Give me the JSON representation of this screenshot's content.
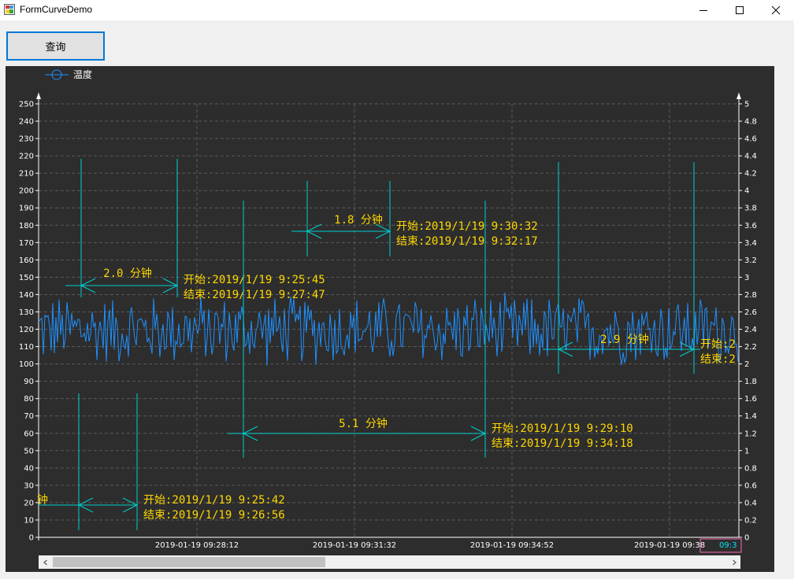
{
  "window": {
    "title": "FormCurveDemo"
  },
  "toolbar": {
    "query_label": "查询"
  },
  "chart_data": {
    "type": "line",
    "legend": [
      "温度"
    ],
    "legend_placement": "top-left",
    "grid": true,
    "x_tick_labels": [
      "2019-01-19 09:28:12",
      "2019-01-19 09:31:32",
      "2019-01-19 09:34:52",
      "2019-01-19 09:38",
      "09:3"
    ],
    "y_left": {
      "ticks": [
        0,
        10,
        20,
        30,
        40,
        50,
        60,
        70,
        80,
        90,
        100,
        110,
        120,
        130,
        140,
        150,
        160,
        170,
        180,
        190,
        200,
        210,
        220,
        230,
        240,
        250
      ],
      "ylim": [
        0,
        250
      ]
    },
    "y_right": {
      "ticks": [
        "0",
        "0.2",
        "0.4",
        "0.6",
        "0.8",
        "1",
        "1.2",
        "1.4",
        "1.6",
        "1.8",
        "2",
        "2.2",
        "2.4",
        "2.6",
        "2.8",
        "3",
        "3.2",
        "3.4",
        "3.6",
        "3.8",
        "4",
        "4.2",
        "4.4",
        "4.6",
        "4.8",
        "5"
      ],
      "ylim": [
        0,
        5
      ]
    },
    "series": [
      {
        "name": "温度",
        "approx_range": [
          97,
          142
        ],
        "color": "#1e90ff"
      }
    ],
    "markers": [
      {
        "duration": "2.0 分钟",
        "start": "开始:2019/1/19 9:25:45",
        "end": "结束:2019/1/19 9:27:47"
      },
      {
        "duration": "1.8 分钟",
        "start": "开始:2019/1/19 9:30:32",
        "end": "结束:2019/1/19 9:32:17"
      },
      {
        "duration": "5.1 分钟",
        "start": "开始:2019/1/19 9:29:10",
        "end": "结束:2019/1/19 9:34:18"
      },
      {
        "duration": "2.9 分钟",
        "start": "开始:2",
        "end": "结束:2"
      },
      {
        "duration": "钟",
        "start": "开始:2019/1/19 9:25:42",
        "end": "结束:2019/1/19 9:26:56"
      }
    ],
    "colors": {
      "background": "#2d2d2d",
      "series": "#1e90ff",
      "marker": "#00d0d0",
      "marker_text": "#ffd700",
      "axis_text": "#ffffff",
      "highlight_box": "#ff69b4"
    }
  }
}
